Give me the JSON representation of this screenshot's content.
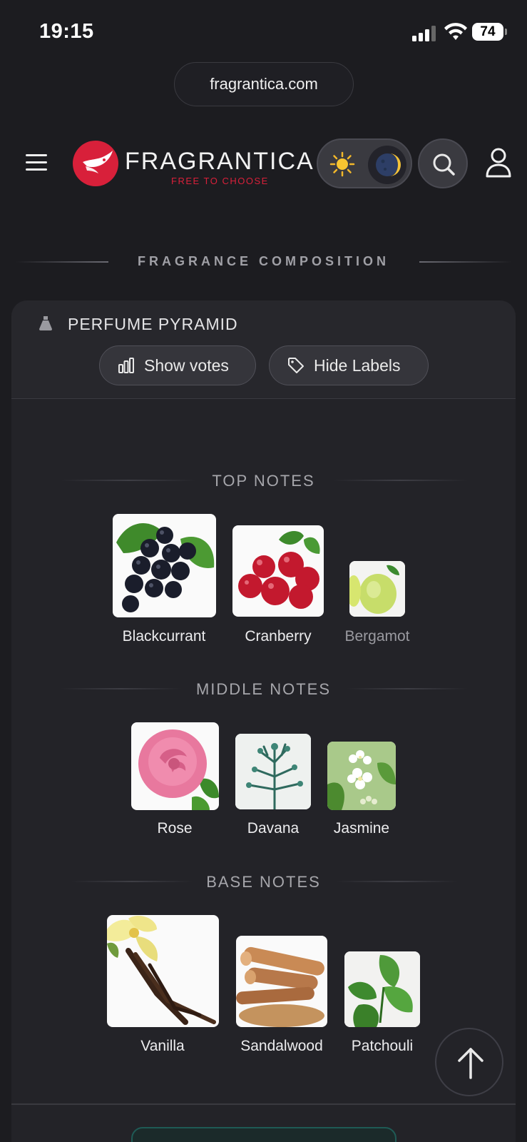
{
  "status_bar": {
    "time": "19:15",
    "battery": "74"
  },
  "browser": {
    "url": "fragrantica.com"
  },
  "header": {
    "brand": "FRAGRANTICA",
    "tagline": "FREE TO CHOOSE"
  },
  "section": {
    "title": "FRAGRANCE COMPOSITION"
  },
  "pyramid": {
    "title": "PERFUME PYRAMID",
    "show_votes_label": "Show votes",
    "hide_labels_label": "Hide Labels",
    "top": {
      "heading": "TOP NOTES",
      "notes": [
        {
          "name": "Blackcurrant"
        },
        {
          "name": "Cranberry"
        },
        {
          "name": "Bergamot"
        }
      ]
    },
    "middle": {
      "heading": "MIDDLE NOTES",
      "notes": [
        {
          "name": "Rose"
        },
        {
          "name": "Davana"
        },
        {
          "name": "Jasmine"
        }
      ]
    },
    "base": {
      "heading": "BASE NOTES",
      "notes": [
        {
          "name": "Vanilla"
        },
        {
          "name": "Sandalwood"
        },
        {
          "name": "Patchouli"
        }
      ]
    }
  },
  "colors": {
    "brand_red": "#d8203a",
    "background": "#1c1c20",
    "card": "#232328"
  }
}
